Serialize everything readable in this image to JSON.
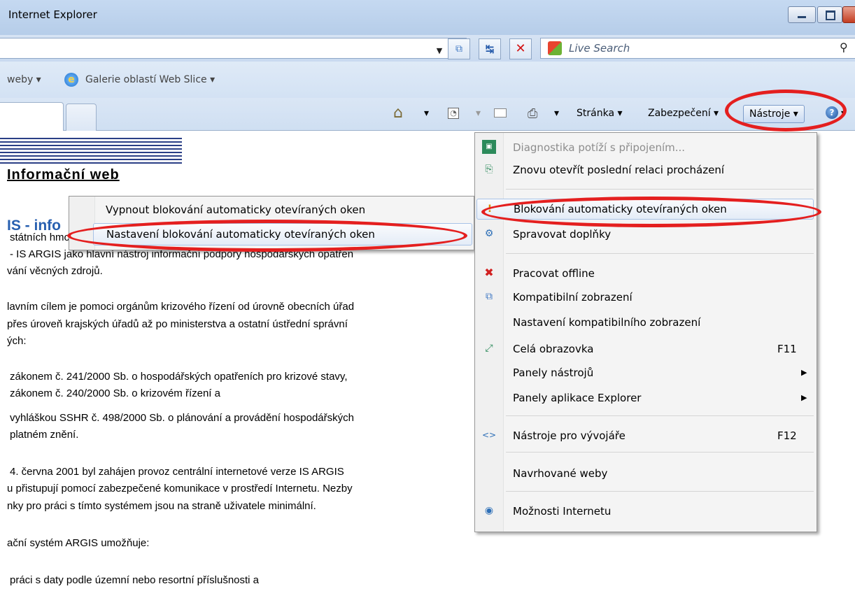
{
  "window": {
    "title": "Internet Explorer"
  },
  "address_bar": {
    "compat_icon": "compat-view-icon",
    "refresh_icon": "refresh-icon",
    "stop_icon": "stop-icon",
    "search_placeholder": "Live Search",
    "search_icon": "magnifier-icon"
  },
  "favorites_bar": {
    "item_weby": "weby ▾",
    "webslice_label": "Galerie oblastí Web Slice ▾"
  },
  "command_bar": {
    "page_menu": "Stránka ▾",
    "safety_menu": "Zabezpečení ▾",
    "tools_menu": "Nástroje ▾",
    "help_icon": "?"
  },
  "page": {
    "header_title": "Informační web",
    "section_heading": "IS - info",
    "paragraphs": [
      "státních hmotných rezerv (dále jen SSHR) vyvíjí a provozuje Informační",
      "- IS ARGIS jako hlavní nástroj informační podpory hospodářských opatřen",
      "vání věcných zdrojů.",
      "lavním cílem je pomoci orgánům krizového řízení od úrovně obecních úřad",
      " přes úroveň krajských úřadů až po ministerstva a ostatní ústřední správní",
      "ých:",
      "zákonem č. 241/2000 Sb. o hospodářských opatřeních pro krizové stavy,",
      "zákonem č. 240/2000 Sb. o krizovém řízení a",
      "vyhláškou SSHR č. 498/2000 Sb. o plánování a provádění hospodářských",
      "platném znění.",
      "4. června 2001 byl zahájen provoz centrální internetové verze IS ARGIS",
      "u přistupují pomocí zabezpečené komunikace v prostředí Internetu. Nezby",
      "nky pro práci s tímto systémem jsou na straně uživatele minimální.",
      "ační systém ARGIS umožňuje:",
      "práci s daty podle územní nebo resortní příslušnosti a"
    ]
  },
  "submenu": {
    "items": [
      "Vypnout blokování automaticky otevíraných oken",
      "Nastavení blokování automaticky otevíraných oken"
    ]
  },
  "tools_menu": {
    "items": [
      {
        "label": "Diagnostika potíží s připojením...",
        "icon": "network-diagnostics-icon",
        "disabled": true
      },
      {
        "label": "Znovu otevřít poslední relaci procházení",
        "icon": "reopen-session-icon"
      },
      {
        "label": "Blokování automaticky otevíraných oken",
        "icon": "popup-blocker-icon"
      },
      {
        "label": "Spravovat doplňky",
        "icon": "addons-icon"
      },
      {
        "label": "Pracovat offline",
        "icon": "offline-icon"
      },
      {
        "label": "Kompatibilní zobrazení",
        "icon": "compat-view-icon"
      },
      {
        "label": "Nastavení kompatibilního zobrazení"
      },
      {
        "label": "Celá obrazovka",
        "shortcut": "F11",
        "icon": "fullscreen-icon"
      },
      {
        "label": "Panely nástrojů",
        "submenu": true
      },
      {
        "label": "Panely aplikace Explorer",
        "submenu": true
      },
      {
        "label": "Nástroje pro vývojáře",
        "shortcut": "F12",
        "icon": "developer-tools-icon"
      },
      {
        "label": "Navrhované weby"
      },
      {
        "label": "Možnosti Internetu",
        "icon": "internet-options-icon"
      }
    ]
  },
  "colors": {
    "annotation": "#e41f1f",
    "heading_blue": "#2860b0"
  }
}
